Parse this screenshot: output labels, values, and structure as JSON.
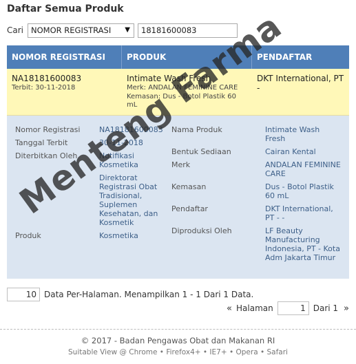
{
  "page": {
    "title": "Daftar Semua Produk"
  },
  "search": {
    "label": "Cari",
    "field_selected": "NOMOR REGISTRASI",
    "query_value": "18181600083"
  },
  "table": {
    "headers": [
      "NOMOR REGISTRASI",
      "PRODUK",
      "PENDAFTAR"
    ],
    "summary": {
      "reg_no": "NA18181600083",
      "terbit": "Terbit: 30-11-2018",
      "product_name": "Intimate Wash Fresh",
      "merk": "Merk: ANDALAN FEMININE CARE",
      "kemasan": "Kemasan: Dus - Botol Plastik 60 mL",
      "pendaftar": "DKT International, PT",
      "pendaftar_extra": "-"
    },
    "detail": {
      "left": {
        "nomor_label": "Nomor Registrasi",
        "nomor_value": "NA18181600083",
        "tanggal_label": "Tanggal Terbit",
        "tanggal_value": "30-11-2018",
        "diterbitkan_label": "Diterbitkan Oleh",
        "diterbitkan_value1": "Notifikasi Kosmetika",
        "diterbitkan_value2": "Direktorat Registrasi Obat Tradisional, Suplemen Kesehatan, dan Kosmetik",
        "produk_label": "Produk",
        "produk_value": "Kosmetika"
      },
      "right": {
        "nama_label": "Nama Produk",
        "nama_value": "Intimate Wash Fresh",
        "bentuk_label": "Bentuk Sediaan",
        "bentuk_value": "Cairan Kental",
        "merk_label": "Merk",
        "merk_value": "ANDALAN FEMININE CARE",
        "kemasan_label": "Kemasan",
        "kemasan_value": "Dus - Botol Plastik 60 mL",
        "pendaftar_label": "Pendaftar",
        "pendaftar_value": "DKT International, PT - -",
        "diproduksi_label": "Diproduksi Oleh",
        "diproduksi_value": "LF Beauty Manufacturing Indonesia, PT - Kota Adm Jakarta Timur"
      }
    }
  },
  "pagination": {
    "per_page": "10",
    "info": "Data Per-Halaman. Menampilkan 1 - 1 Dari 1 Data.",
    "prev": "«",
    "halaman_label": "Halaman",
    "current_page": "1",
    "total": "Dari 1",
    "next": "»"
  },
  "footer": {
    "copyright": "© 2017 - Badan Pengawas Obat dan Makanan RI",
    "compat": "Suitable View @ Chrome • Firefox4+ • IE7+ • Opera • Safari"
  },
  "watermark": "Menteng Farma",
  "colors": {
    "header_bg": "#4f7fb8",
    "summary_bg": "#fff8b8",
    "detail_bg": "#dbe5f1"
  }
}
